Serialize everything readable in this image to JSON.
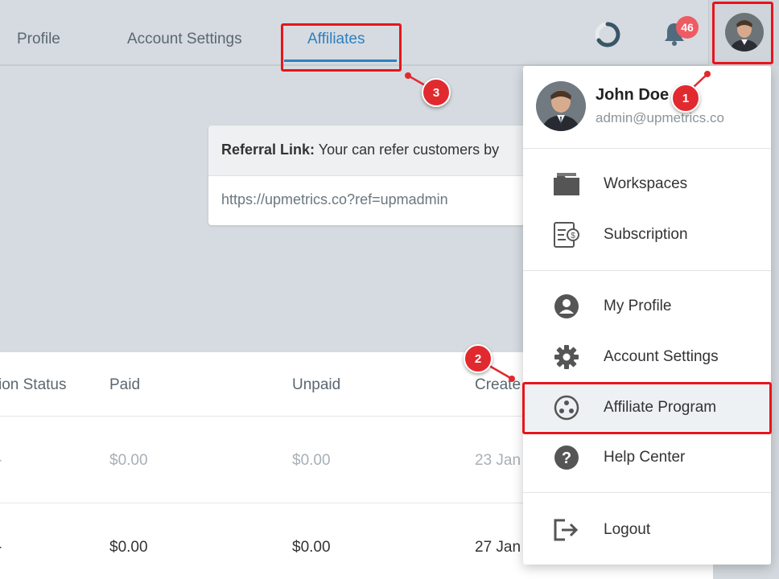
{
  "tabs": [
    {
      "label": "Profile",
      "active": false
    },
    {
      "label": "Account Settings",
      "active": false
    },
    {
      "label": "Affiliates",
      "active": true
    }
  ],
  "notifications": {
    "count": "46",
    "icon": "bell-icon"
  },
  "status_icon": "loader-ring-icon",
  "referral": {
    "heading_bold": "Referral Link:",
    "heading_text": " Your can refer customers by",
    "link": "https://upmetrics.co?ref=upmadmin"
  },
  "table": {
    "headers": [
      "ion Status",
      "Paid",
      "Unpaid",
      "Create"
    ],
    "rows": [
      {
        "status": "-",
        "paid": "$0.00",
        "unpaid": "$0.00",
        "created": "23 Jan",
        "style": "faded"
      },
      {
        "status": "-",
        "paid": "$0.00",
        "unpaid": "$0.00",
        "created": "27 Jan",
        "style": "normal"
      }
    ]
  },
  "user_menu": {
    "name": "John Doe",
    "email": "admin@upmetrics.co",
    "items": [
      {
        "label": "Workspaces",
        "icon": "folder-icon"
      },
      {
        "label": "Subscription",
        "icon": "invoice-icon"
      },
      {
        "label": "My Profile",
        "icon": "user-circle-icon"
      },
      {
        "label": "Account Settings",
        "icon": "gear-icon"
      },
      {
        "label": "Affiliate Program",
        "icon": "affiliate-icon"
      },
      {
        "label": "Help Center",
        "icon": "help-icon"
      },
      {
        "label": "Logout",
        "icon": "logout-icon"
      }
    ]
  },
  "annotations": {
    "marker_1": "1",
    "marker_2": "2",
    "marker_3": "3",
    "highlight_color": "#e8141b"
  },
  "colors": {
    "accent": "#2f7fc1",
    "badge": "#ef5b63",
    "background": "#d5dbe0"
  }
}
